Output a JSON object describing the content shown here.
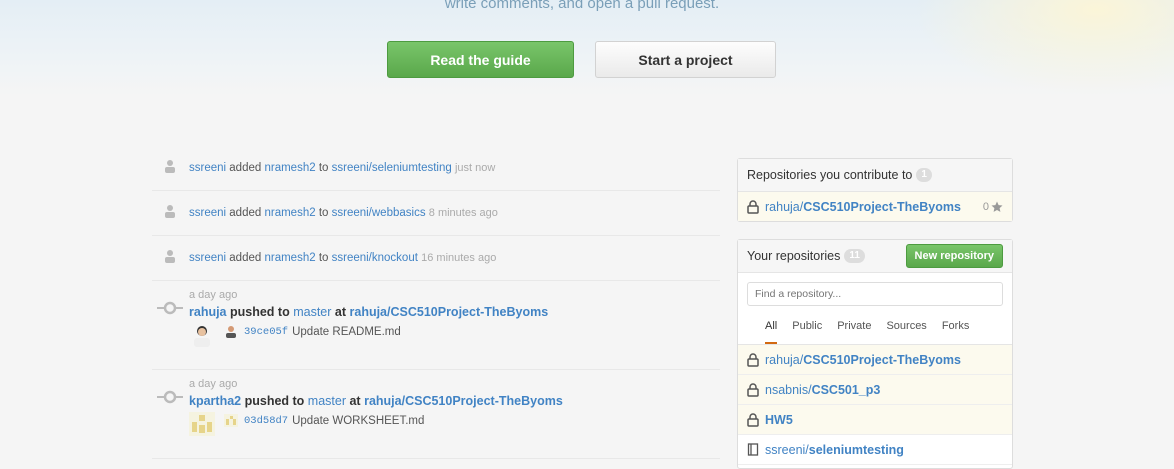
{
  "hero": {
    "subtitle": "write comments, and open a pull request.",
    "primary_button": "Read the guide",
    "secondary_button": "Start a project"
  },
  "feed": {
    "simple_items": [
      {
        "actor": "ssreeni",
        "verb": "added",
        "target": "nramesh2",
        "prep": "to",
        "repo": "ssreeni/seleniumtesting",
        "time": "just now"
      },
      {
        "actor": "ssreeni",
        "verb": "added",
        "target": "nramesh2",
        "prep": "to",
        "repo": "ssreeni/webbasics",
        "time": "8 minutes ago"
      },
      {
        "actor": "ssreeni",
        "verb": "added",
        "target": "nramesh2",
        "prep": "to",
        "repo": "ssreeni/knockout",
        "time": "16 minutes ago"
      }
    ],
    "push_items": [
      {
        "time": "a day ago",
        "actor": "rahuja",
        "verb": "pushed to",
        "branch": "master",
        "at": "at",
        "repo": "rahuja/CSC510Project-TheByoms",
        "sha": "39ce05f",
        "message": "Update README.md"
      },
      {
        "time": "a day ago",
        "actor": "kpartha2",
        "verb": "pushed to",
        "branch": "master",
        "at": "at",
        "repo": "rahuja/CSC510Project-TheByoms",
        "sha": "03d58d7",
        "message": "Update WORKSHEET.md"
      }
    ]
  },
  "contribute_box": {
    "title": "Repositories you contribute to",
    "count": "1",
    "repos": [
      {
        "owner": "rahuja/",
        "name": "CSC510Project-TheByoms",
        "stars": "0",
        "icon": "lock-icon"
      }
    ]
  },
  "your_repos": {
    "title": "Your repositories",
    "count": "11",
    "new_button": "New repository",
    "search_placeholder": "Find a repository...",
    "filters": [
      "All",
      "Public",
      "Private",
      "Sources",
      "Forks"
    ],
    "active_filter": "All",
    "repos": [
      {
        "owner": "rahuja/",
        "name": "CSC510Project-TheByoms",
        "icon": "lock-icon"
      },
      {
        "owner": "nsabnis/",
        "name": "CSC501_p3",
        "icon": "lock-icon"
      },
      {
        "owner": "",
        "name": "HW5",
        "icon": "lock-icon"
      },
      {
        "owner": "ssreeni/",
        "name": "seleniumtesting",
        "icon": "repo-icon"
      }
    ]
  },
  "colors": {
    "accent": "#4183c4",
    "green_button": "#5aa84b",
    "tab_underline": "#d26911"
  }
}
